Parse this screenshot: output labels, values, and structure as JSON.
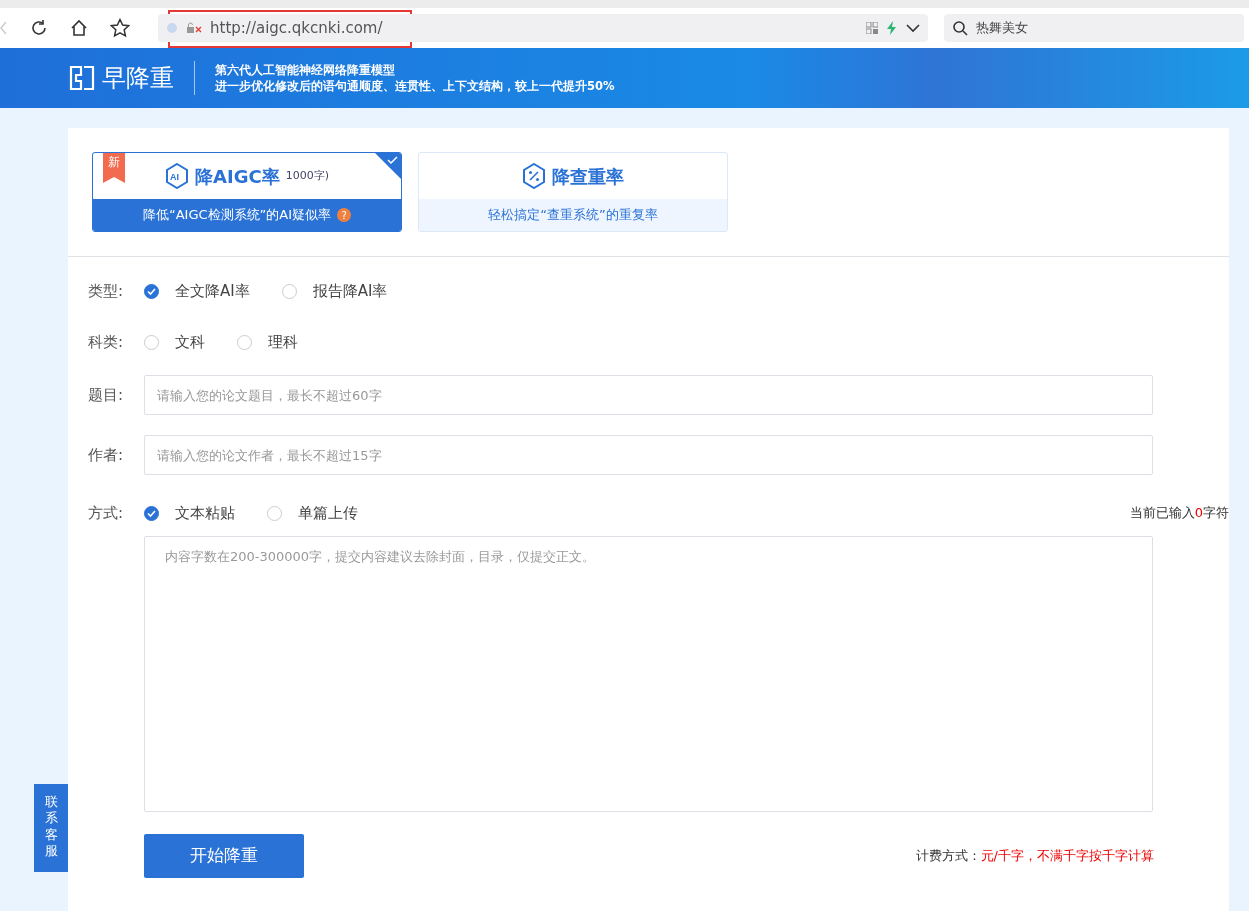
{
  "browser": {
    "url": "http://aigc.qkcnki.com/",
    "search": {
      "placeholder": "热舞美女"
    },
    "annotation": true
  },
  "header": {
    "logo": "早降重",
    "taglines": [
      "第六代人工智能神经网络降重模型",
      "进一步优化修改后的语句通顺度、连贯性、上下文结构，较上一代提升50%"
    ]
  },
  "services": [
    {
      "kind": "ai",
      "icon_label": "AI",
      "title": "降AIGC率",
      "price": "1000字)",
      "subtitle": "降低“AIGC检测系统”的AI疑似率",
      "badge": "新",
      "help": "?",
      "selected": true
    },
    {
      "kind": "dup",
      "title": "降查重率",
      "subtitle": "轻松搞定“查重系统”的重复率",
      "selected": false
    }
  ],
  "form": {
    "type": {
      "label": "类型:",
      "options": [
        {
          "label": "全文降AI率",
          "selected": true
        },
        {
          "label": "报告降AI率",
          "selected": false
        }
      ]
    },
    "subject": {
      "label": "科类:",
      "options": [
        {
          "label": "文科",
          "selected": false
        },
        {
          "label": "理科",
          "selected": false
        }
      ]
    },
    "title": {
      "label": "题目:",
      "placeholder": "请输入您的论文题目，最长不超过60字"
    },
    "author": {
      "label": "作者:",
      "placeholder": "请输入您的论文作者，最长不超过15字"
    },
    "method": {
      "label": "方式:",
      "options": [
        {
          "label": "文本粘贴",
          "selected": true
        },
        {
          "label": "单篇上传",
          "selected": false
        }
      ]
    },
    "counter": {
      "prefix": "当前已输入",
      "count": "0",
      "suffix": "字符"
    },
    "content": {
      "placeholder": "内容字数在200-300000字，提交内容建议去除封面，目录，仅提交正文。"
    },
    "submit": "开始降重",
    "fee": {
      "label": "计费方式：",
      "value": "元/千字，不满千字按千字计算"
    }
  },
  "contact": "联系客服"
}
